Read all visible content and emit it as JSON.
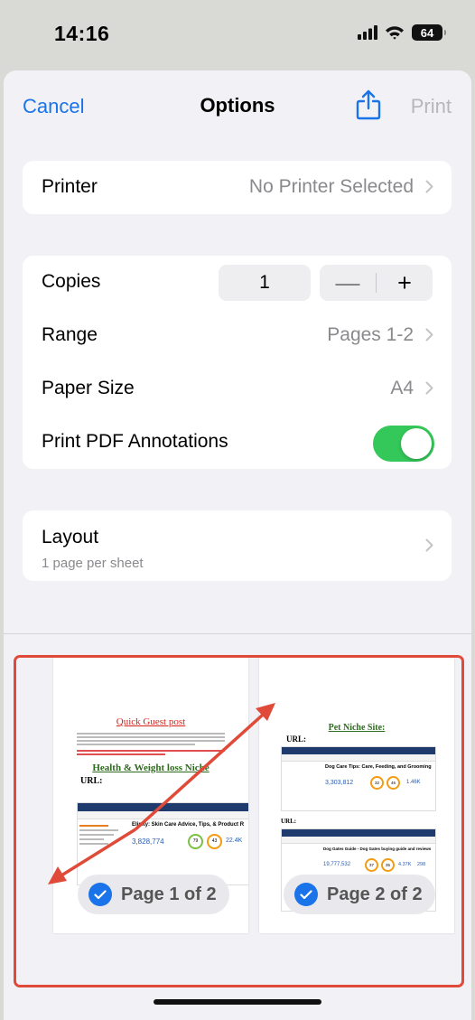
{
  "status_bar": {
    "time": "14:16",
    "battery": "64"
  },
  "nav": {
    "cancel": "Cancel",
    "title": "Options",
    "print": "Print"
  },
  "printer": {
    "label": "Printer",
    "value": "No Printer Selected"
  },
  "copies": {
    "label": "Copies",
    "value": "1",
    "minus": "—",
    "plus": "+"
  },
  "range": {
    "label": "Range",
    "value": "Pages 1-2"
  },
  "paper_size": {
    "label": "Paper Size",
    "value": "A4"
  },
  "annotations": {
    "label": "Print PDF Annotations",
    "enabled": true
  },
  "layout": {
    "label": "Layout",
    "subtitle": "1 page per sheet"
  },
  "pages": [
    {
      "badge": "Page 1 of 2",
      "selected": true,
      "heading": "Quick Guest post",
      "subheading": "Health & Weight loss Niche",
      "url_label": "URL:",
      "site_title": "Elinity: Skin Care Advice, Tips, & Product R",
      "stats": [
        "3,828,774",
        "79",
        "43",
        "22.4K"
      ]
    },
    {
      "badge": "Page 2 of 2",
      "selected": true,
      "heading": "Pet Niche Site:",
      "url_label": "URL:",
      "site_title": "Dog Care Tips: Care, Feeding, and Grooming",
      "stats": [
        "3,303,812",
        "32",
        "46",
        "1.46K"
      ],
      "site_title_2": "Dog Gates Guide - Dog Gates buying guide and reviews",
      "stats_2": [
        "19,777,532",
        "37",
        "35",
        "4.37K",
        "298"
      ]
    }
  ],
  "colors": {
    "accent": "#1a73e8",
    "toggle_on": "#34c759",
    "annotation": "#e04a39"
  }
}
